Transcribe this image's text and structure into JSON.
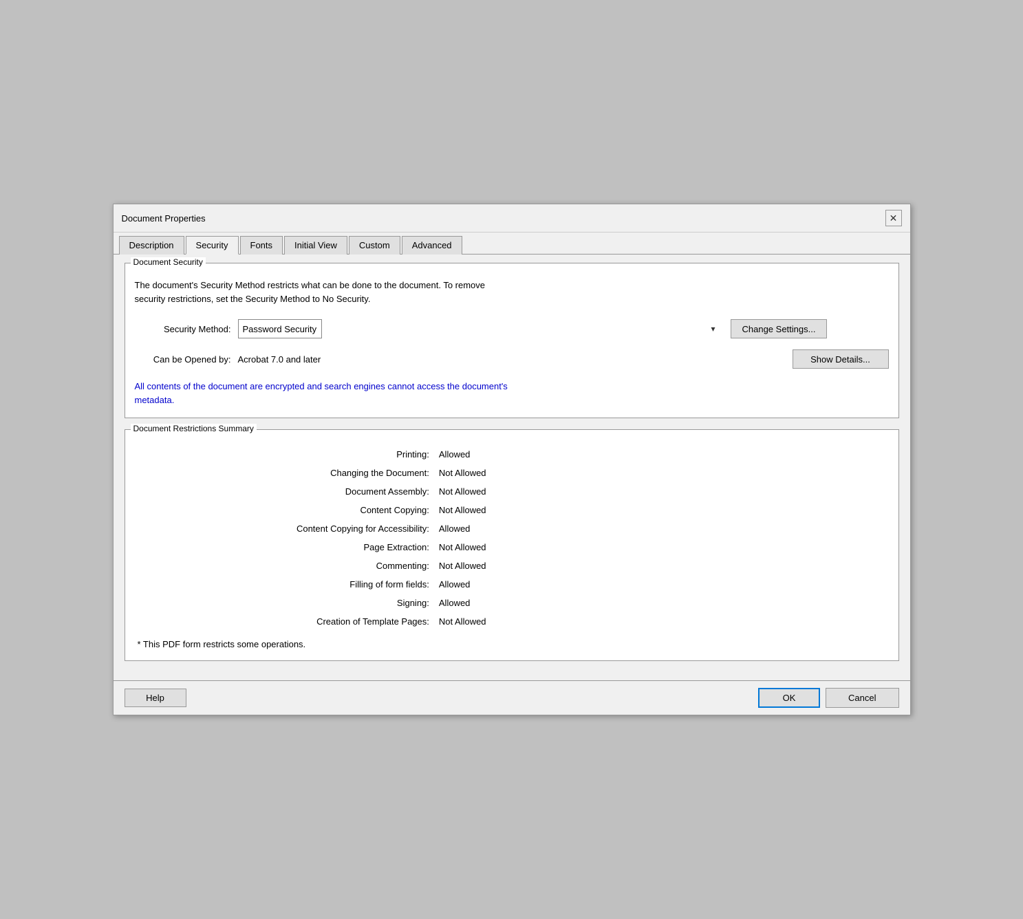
{
  "dialog": {
    "title": "Document Properties",
    "close_label": "✕"
  },
  "tabs": [
    {
      "id": "description",
      "label": "Description",
      "active": false
    },
    {
      "id": "security",
      "label": "Security",
      "active": true
    },
    {
      "id": "fonts",
      "label": "Fonts",
      "active": false
    },
    {
      "id": "initial-view",
      "label": "Initial View",
      "active": false
    },
    {
      "id": "custom",
      "label": "Custom",
      "active": false
    },
    {
      "id": "advanced",
      "label": "Advanced",
      "active": false
    }
  ],
  "document_security": {
    "section_title": "Document Security",
    "description_line1": "The document's Security Method restricts what can be done to the document. To remove",
    "description_line2": "security restrictions, set the Security Method to No Security.",
    "security_method_label": "Security Method:",
    "security_method_value": "Password Security",
    "change_settings_label": "Change Settings...",
    "can_be_opened_label": "Can be Opened by:",
    "can_be_opened_value": "Acrobat 7.0 and later",
    "show_details_label": "Show Details...",
    "info_text_line1": "All contents of the document are encrypted and search engines cannot access the document's",
    "info_text_line2": "metadata."
  },
  "restrictions_summary": {
    "section_title": "Document Restrictions Summary",
    "rows": [
      {
        "label": "Printing:",
        "value": "Allowed"
      },
      {
        "label": "Changing the Document:",
        "value": "Not Allowed"
      },
      {
        "label": "Document Assembly:",
        "value": "Not Allowed"
      },
      {
        "label": "Content Copying:",
        "value": "Not Allowed"
      },
      {
        "label": "Content Copying for Accessibility:",
        "value": "Allowed"
      },
      {
        "label": "Page Extraction:",
        "value": "Not Allowed"
      },
      {
        "label": "Commenting:",
        "value": "Not Allowed"
      },
      {
        "label": "Filling of form fields:",
        "value": "Allowed"
      },
      {
        "label": "Signing:",
        "value": "Allowed"
      },
      {
        "label": "Creation of Template Pages:",
        "value": "Not Allowed"
      }
    ],
    "footnote": "*   This PDF form restricts some operations."
  },
  "footer": {
    "help_label": "Help",
    "ok_label": "OK",
    "cancel_label": "Cancel"
  }
}
